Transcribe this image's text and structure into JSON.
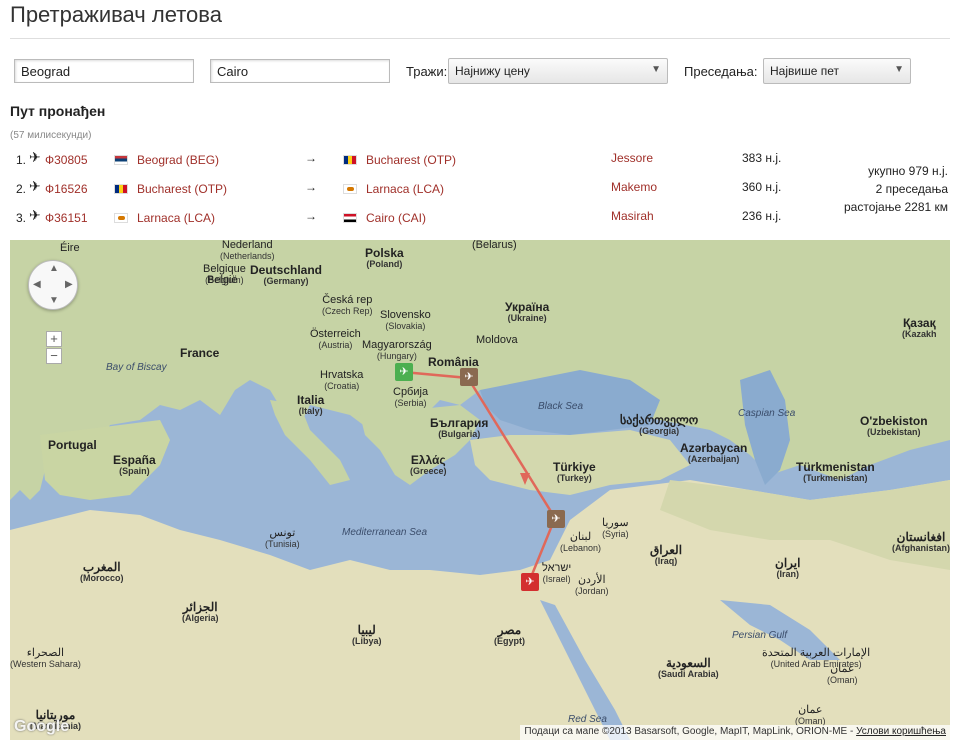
{
  "header": {
    "title": "Претраживач летова"
  },
  "search": {
    "from_value": "Beograd",
    "to_value": "Cairo",
    "search_label": "Тражи:",
    "search_select": "Најнижу цену",
    "stops_label": "Преседања:",
    "stops_select": "Највише пет"
  },
  "result": {
    "heading": "Пут пронађен",
    "timing": "(57 милисекунди)",
    "legs": [
      {
        "num": "1.",
        "flight": "Ф30805",
        "from": "Beograd (BEG)",
        "arrow": "→",
        "to": "Bucharest (OTP)",
        "airline": "Jessore",
        "distance": "383 н.ј.",
        "from_flag": "rs",
        "to_flag": "ro"
      },
      {
        "num": "2.",
        "flight": "Ф16526",
        "from": "Bucharest (OTP)",
        "arrow": "→",
        "to": "Larnaca (LCA)",
        "airline": "Makemo",
        "distance": "360 н.ј.",
        "from_flag": "ro",
        "to_flag": "cy"
      },
      {
        "num": "3.",
        "flight": "Ф36151",
        "from": "Larnaca (LCA)",
        "arrow": "→",
        "to": "Cairo (CAI)",
        "airline": "Masirah",
        "distance": "236 н.ј.",
        "from_flag": "cy",
        "to_flag": "eg"
      }
    ],
    "summary_total": "укупно 979 н.ј.",
    "summary_stops": "2 преседања",
    "summary_distance": "растојање 2281 км"
  },
  "map": {
    "labels": {
      "eire": "Éire",
      "nederland": "Nederland",
      "nederland_sub": "(Netherlands)",
      "belgique": "Belgique",
      "belgie": "België",
      "belgium_sub": "(Belgium)",
      "deutschland": "Deutschland",
      "deutschland_sub": "(Germany)",
      "polska": "Polska",
      "polska_sub": "(Poland)",
      "belarus": "(Belarus)",
      "ceska": "Česká rep",
      "ceska_sub": "(Czech Rep)",
      "slovensko": "Slovensko",
      "slovensko_sub": "(Slovakia)",
      "ukraina": "Україна",
      "ukraina_sub": "(Ukraine)",
      "kazakh": "Қазақ",
      "kazakh_sub": "(Kazakh",
      "osterreich": "Österreich",
      "osterreich_sub": "(Austria)",
      "magyarorszag": "Magyarország",
      "magyar_sub": "(Hungary)",
      "moldova": "Moldova",
      "france": "France",
      "bay_biscay": "Bay of Biscay",
      "hrvatska": "Hrvatska",
      "hrvatska_sub": "(Croatia)",
      "romania": "România",
      "srbija": "Србија",
      "srbija_sub": "(Serbia)",
      "italia": "Italia",
      "italia_sub": "(Italy)",
      "bulgaria": "България",
      "bulgaria_sub": "(Bulgaria)",
      "black_sea": "Black Sea",
      "georgia": "საქართველო",
      "georgia_sub": "(Georgia)",
      "caspian": "Caspian Sea",
      "ozbekiston": "O'zbekiston",
      "ozbekiston_sub": "(Uzbekistan)",
      "portugal": "Portugal",
      "espana": "España",
      "espana_sub": "(Spain)",
      "ellas": "Ελλάς",
      "ellas_sub": "(Greece)",
      "turkiye": "Türkiye",
      "turkiye_sub": "(Turkey)",
      "azerbaycan": "Azərbaycan",
      "azerbaycan_sub": "(Azerbaijan)",
      "turkmenistan": "Türkmenistan",
      "turkmenistan_sub": "(Turkmenistan)",
      "mediterranean": "Mediterranean Sea",
      "tunisia": "تونس",
      "tunisia_sub": "(Tunisia)",
      "syria": "سوريا",
      "syria_sub": "(Syria)",
      "lebanon": "لبنان",
      "lebanon_sub": "(Lebanon)",
      "iraq": "العراق",
      "iraq_sub": "(Iraq)",
      "iran": "ایران",
      "iran_sub": "(Iran)",
      "afghanistan": "افغانستان",
      "afghanistan_sub": "(Afghanistan)",
      "morocco": "المغرب",
      "morocco_sub": "(Morocco)",
      "israel": "ישראל",
      "israel_sub": "(Israel)",
      "jordan": "الأردن",
      "jordan_sub": "(Jordan)",
      "algeria": "الجزائر",
      "algeria_sub": "(Algeria)",
      "libya": "ليبيا",
      "libya_sub": "(Libya)",
      "egypt": "مصر",
      "egypt_sub": "(Egypt)",
      "persian_gulf": "Persian Gulf",
      "saudi": "السعودية",
      "saudi_sub": "(Saudi Arabia)",
      "uae": "الإمارات العربية المتحدة",
      "uae_sub": "(United Arab Emirates)",
      "oman": "عمان",
      "oman_sub": "(Oman)",
      "oman2": "عمان",
      "oman2_sub": "(Oman)",
      "western_sahara": "الصحراء",
      "western_sahara_sub": "(Western Sahara)",
      "mauritania": "موريتانيا",
      "mauritania_sub": "(Mauritania)",
      "red_sea": "Red Sea"
    },
    "attribution": "Подаци са мапе ©2013 Basarsoft, Google, MapIT, MapLink, ORION-ME -",
    "terms": "Услови коришћења",
    "logo": "Google",
    "zoom_in": "+",
    "zoom_out": "−",
    "colors": {
      "water": "#9bb6d6",
      "land": "#c9d7a8",
      "desert": "#e6e2c3",
      "route": "#e0685a",
      "start_marker": "#4caf50",
      "stop_marker": "#8a6a50",
      "end_marker": "#d32f2f"
    }
  }
}
